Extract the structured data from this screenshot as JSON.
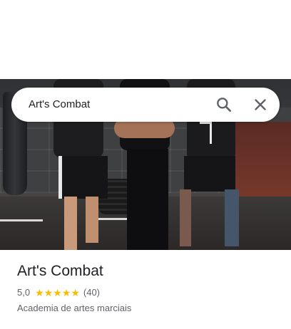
{
  "search": {
    "query": "Art's Combat",
    "search_icon": "search-icon",
    "close_icon": "close-icon"
  },
  "place": {
    "name": "Art's Combat",
    "rating": "5,0",
    "stars": 5,
    "reviews": "(40)",
    "category": "Academia de artes marciais"
  },
  "colors": {
    "star": "#fbbc04",
    "text_primary": "#202124",
    "text_secondary": "#5f6368"
  }
}
